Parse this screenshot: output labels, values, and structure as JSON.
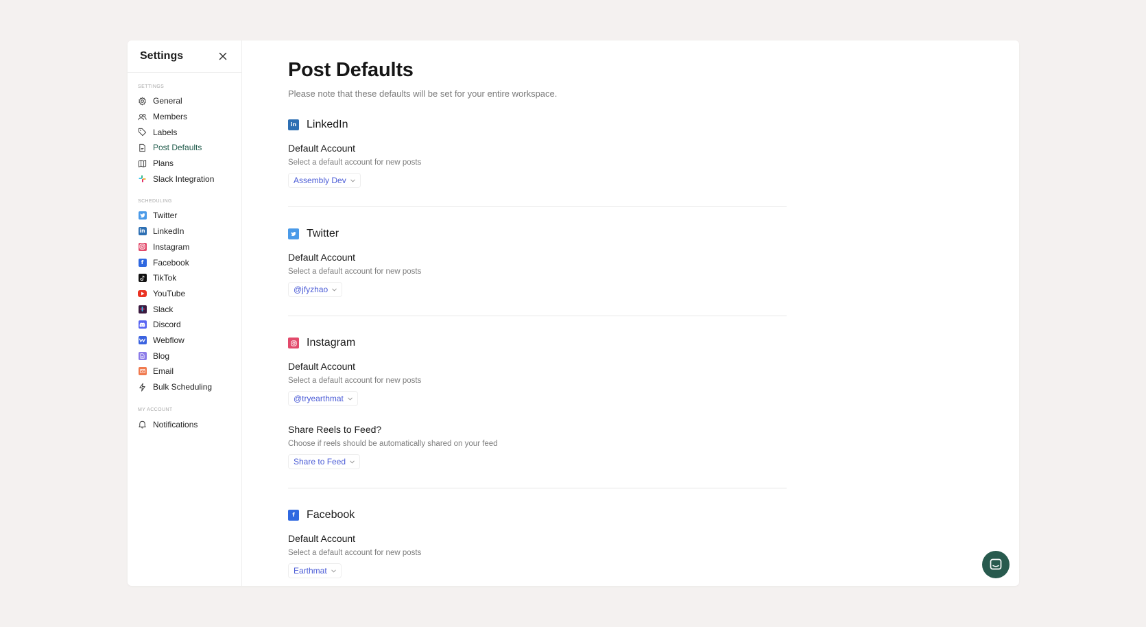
{
  "sidebar": {
    "title": "Settings",
    "sections": [
      {
        "label": "SETTINGS",
        "items": [
          {
            "label": "General",
            "icon": "gear-icon"
          },
          {
            "label": "Members",
            "icon": "users-icon"
          },
          {
            "label": "Labels",
            "icon": "tag-icon"
          },
          {
            "label": "Post Defaults",
            "icon": "document-icon",
            "active": true
          },
          {
            "label": "Plans",
            "icon": "map-icon"
          },
          {
            "label": "Slack Integration",
            "icon": "slack-icon"
          }
        ]
      },
      {
        "label": "SCHEDULING",
        "items": [
          {
            "label": "Twitter",
            "icon": "twitter-icon",
            "color": "#4a9ae8"
          },
          {
            "label": "LinkedIn",
            "icon": "linkedin-icon",
            "color": "#2d6fb3"
          },
          {
            "label": "Instagram",
            "icon": "instagram-icon",
            "color": "#e24a6b"
          },
          {
            "label": "Facebook",
            "icon": "facebook-icon",
            "color": "#2f68e0"
          },
          {
            "label": "TikTok",
            "icon": "tiktok-icon",
            "color": "#111111"
          },
          {
            "label": "YouTube",
            "icon": "youtube-icon",
            "color": "#ea3323"
          },
          {
            "label": "Slack",
            "icon": "slack-icon",
            "color": "#3b1a3f"
          },
          {
            "label": "Discord",
            "icon": "discord-icon",
            "color": "#5865f2"
          },
          {
            "label": "Webflow",
            "icon": "webflow-icon",
            "color": "#3b63e0"
          },
          {
            "label": "Blog",
            "icon": "blog-icon",
            "color": "#8b7be8"
          },
          {
            "label": "Email",
            "icon": "email-icon",
            "color": "#f07a4f"
          },
          {
            "label": "Bulk Scheduling",
            "icon": "lightning-icon"
          }
        ]
      },
      {
        "label": "MY ACCOUNT",
        "items": [
          {
            "label": "Notifications",
            "icon": "bell-icon"
          }
        ]
      }
    ]
  },
  "main": {
    "title": "Post Defaults",
    "subtitle": "Please note that these defaults will be set for your entire workspace.",
    "platforms": [
      {
        "name": "LinkedIn",
        "icon": "linkedin-icon",
        "color": "#2d6fb3",
        "fields": [
          {
            "title": "Default Account",
            "desc": "Select a default account for new posts",
            "value": "Assembly Dev"
          }
        ]
      },
      {
        "name": "Twitter",
        "icon": "twitter-icon",
        "color": "#4a9ae8",
        "fields": [
          {
            "title": "Default Account",
            "desc": "Select a default account for new posts",
            "value": "@jfyzhao"
          }
        ]
      },
      {
        "name": "Instagram",
        "icon": "instagram-icon",
        "color": "#e24a6b",
        "fields": [
          {
            "title": "Default Account",
            "desc": "Select a default account for new posts",
            "value": "@tryearthmat"
          },
          {
            "title": "Share Reels to Feed?",
            "desc": "Choose if reels should be automatically shared on your feed",
            "value": "Share to Feed"
          }
        ]
      },
      {
        "name": "Facebook",
        "icon": "facebook-icon",
        "color": "#2f68e0",
        "fields": [
          {
            "title": "Default Account",
            "desc": "Select a default account for new posts",
            "value": "Earthmat"
          }
        ]
      }
    ]
  },
  "colors": {
    "accent_link": "#4a5bd6",
    "active_nav": "#1f5a4a",
    "help_button": "#285a4e"
  }
}
